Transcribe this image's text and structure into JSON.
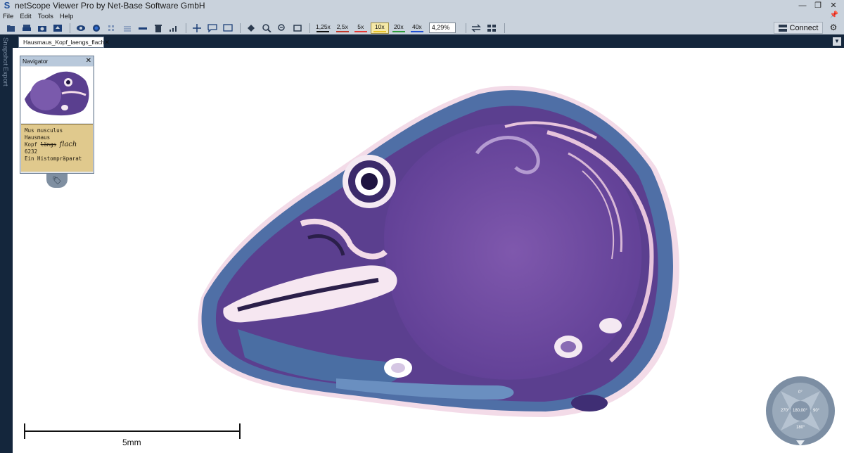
{
  "app": {
    "title": "netScope Viewer Pro by Net-Base Software GmbH",
    "logo_letter": "S",
    "window_buttons": [
      "—",
      "❐",
      "✕"
    ]
  },
  "menu": {
    "items": [
      "File",
      "Edit",
      "Tools",
      "Help"
    ]
  },
  "toolbar": {
    "zoom_presets": [
      {
        "label": "1,25x",
        "color": "#111111"
      },
      {
        "label": "2,5x",
        "color": "#c0392b"
      },
      {
        "label": "5x",
        "color": "#e53935"
      },
      {
        "label": "10x",
        "color": "#e6c229"
      },
      {
        "label": "20x",
        "color": "#2e9c3c"
      },
      {
        "label": "40x",
        "color": "#1e4fd1"
      }
    ],
    "active_zoom": "10x",
    "zoom_value": "4,29%",
    "connect_label": "Connect"
  },
  "tabs": {
    "document": "Hausmaus_Kopf_laengs_flach",
    "close": "✕"
  },
  "side_tabs": [
    "Snapshot",
    "Export"
  ],
  "navigator": {
    "title": "Navigator",
    "close": "✕",
    "label_lines": [
      "Mus musculus",
      "Hausmaus",
      "Kopf",
      "6232",
      "Ein Histompräparat"
    ],
    "label_handwritten": "flach",
    "label_struck": "längs"
  },
  "scalebar": {
    "label": "5mm"
  },
  "rotation": {
    "top": "0°",
    "right": "90°",
    "bottom": "180°",
    "left": "270°",
    "center": "180,00°"
  },
  "colors": {
    "chrome": "#c9d2dc",
    "dark_band": "#14263c",
    "tissue_purple": "#6a3f9a",
    "tissue_blue": "#5d7fb0"
  }
}
